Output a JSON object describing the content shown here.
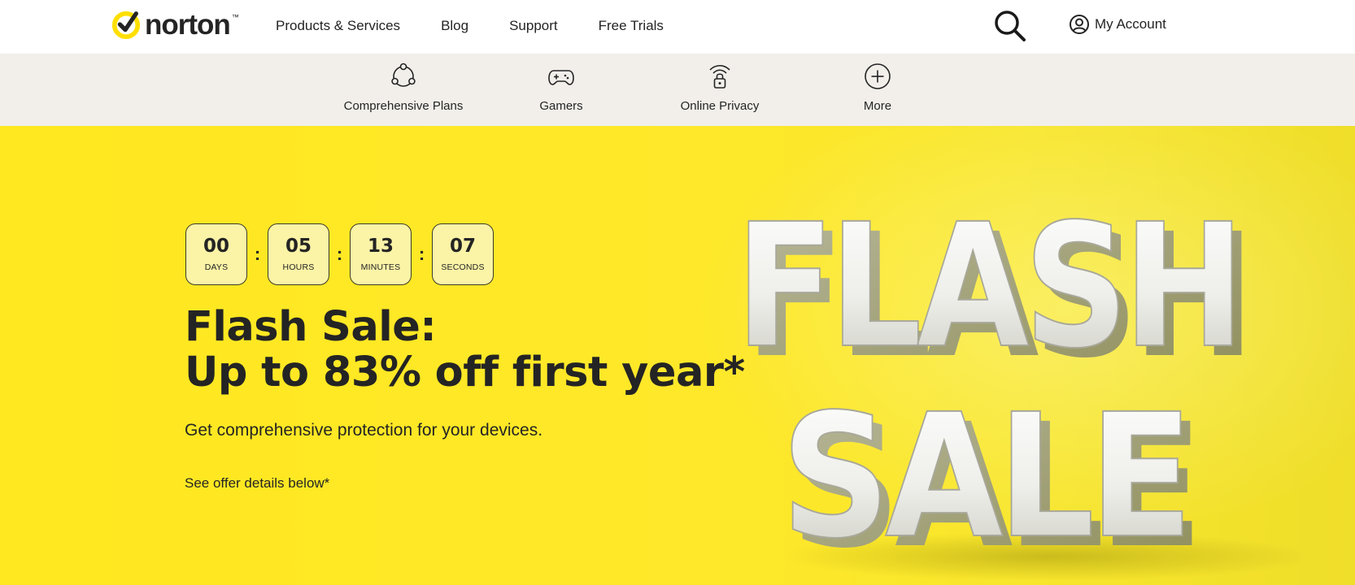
{
  "brand": {
    "name": "norton",
    "tm": "™",
    "accent_color": "#ffdf00",
    "text_color": "#242424"
  },
  "topnav": {
    "links": [
      {
        "label": "Products & Services"
      },
      {
        "label": "Blog"
      },
      {
        "label": "Support"
      },
      {
        "label": "Free Trials"
      }
    ],
    "search_icon": "search-icon",
    "account": {
      "icon": "user-circle-icon",
      "label": "My Account"
    }
  },
  "subnav": {
    "items": [
      {
        "label": "Comprehensive Plans",
        "icon": "connected-circles-icon"
      },
      {
        "label": "Gamers",
        "icon": "gamepad-icon"
      },
      {
        "label": "Online Privacy",
        "icon": "wifi-lock-icon"
      },
      {
        "label": "More",
        "icon": "plus-circle-icon"
      }
    ]
  },
  "hero": {
    "countdown": [
      {
        "value": "00",
        "unit": "DAYS"
      },
      {
        "value": "05",
        "unit": "HOURS"
      },
      {
        "value": "13",
        "unit": "MINUTES"
      },
      {
        "value": "07",
        "unit": "SECONDS"
      }
    ],
    "separator": ":",
    "title_line1": "Flash Sale:",
    "title_line2": "Up to 83% off first year*",
    "subtitle": "Get comprehensive protection for your devices.",
    "offer_link": "See offer details below*",
    "art_line1": "FLASH",
    "art_line2": "SALE"
  }
}
